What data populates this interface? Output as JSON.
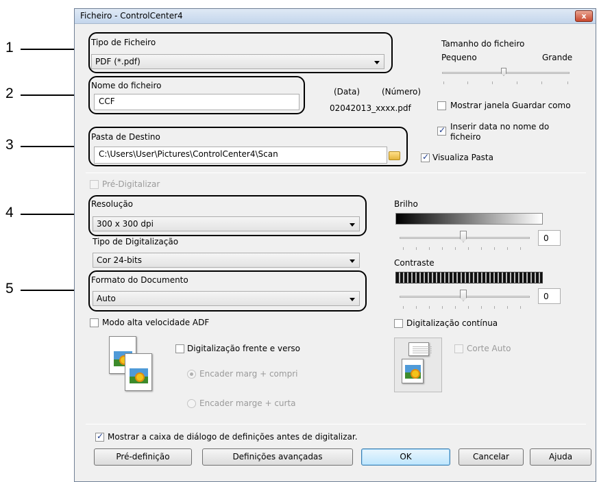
{
  "window": {
    "title": "Ficheiro - ControlCenter4",
    "close_label": "x"
  },
  "callouts": [
    "1",
    "2",
    "3",
    "4",
    "5"
  ],
  "file_type": {
    "label": "Tipo de Ficheiro",
    "value": "PDF (*.pdf)"
  },
  "file_size": {
    "label": "Tamanho do ficheiro",
    "small_label": "Pequeno",
    "large_label": "Grande"
  },
  "file_name": {
    "label": "Nome do ficheiro",
    "value": "CCF",
    "date_label": "(Data)",
    "number_label": "(Número)",
    "preview": "02042013_xxxx.pdf"
  },
  "show_save_as": {
    "label": "Mostrar janela Guardar como",
    "checked": false
  },
  "insert_date": {
    "label_line1": "Inserir data no nome do",
    "label_line2": "ficheiro",
    "checked": true
  },
  "destination": {
    "label": "Pasta de Destino",
    "value": "C:\\Users\\User\\Pictures\\ControlCenter4\\Scan"
  },
  "view_folder": {
    "label": "Visualiza Pasta",
    "checked": true
  },
  "prescan": {
    "label": "Pré-Digitalizar",
    "checked": false,
    "enabled": false
  },
  "resolution": {
    "label": "Resolução",
    "value": "300 x 300 dpi"
  },
  "scan_type": {
    "label": "Tipo de Digitalização",
    "value": "Cor 24-bits"
  },
  "document_size": {
    "label": "Formato do Documento",
    "value": "Auto"
  },
  "brightness": {
    "label": "Brilho",
    "value": "0"
  },
  "contrast": {
    "label": "Contraste",
    "value": "0"
  },
  "adf_high_speed": {
    "label": "Modo alta velocidade ADF",
    "checked": false
  },
  "continuous_scan": {
    "label": "Digitalização contínua",
    "checked": false
  },
  "duplex": {
    "label": "Digitalização frente e verso",
    "checked": false
  },
  "duplex_long": {
    "label": "Encader marg + compri",
    "selected": true
  },
  "duplex_short": {
    "label": "Encader marge + curta",
    "selected": false
  },
  "auto_crop": {
    "label": "Corte Auto",
    "checked": false
  },
  "show_settings_dialog": {
    "label": "Mostrar a caixa de diálogo de definições antes de digitalizar.",
    "checked": true
  },
  "buttons": {
    "default": "Pré-definição",
    "advanced": "Definições avançadas",
    "ok": "OK",
    "cancel": "Cancelar",
    "help": "Ajuda"
  }
}
